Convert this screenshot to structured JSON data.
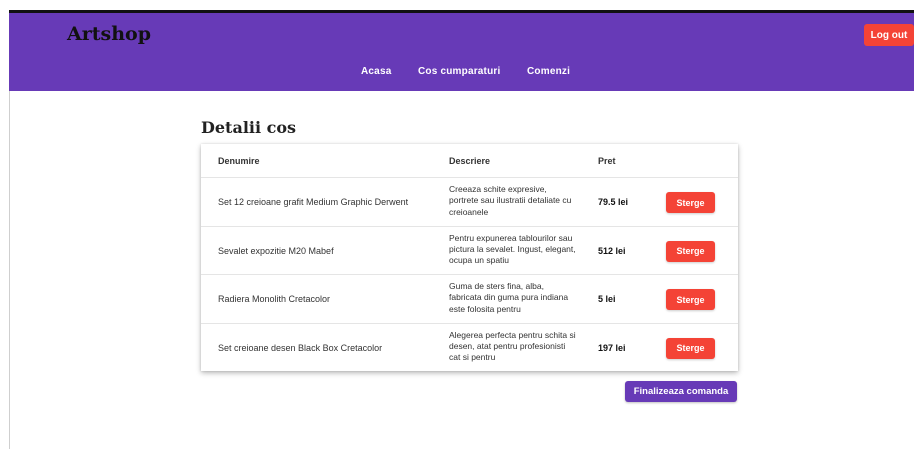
{
  "theme": {
    "accent": "#673ab7",
    "danger": "#f44336"
  },
  "header": {
    "brand": "Artshop",
    "logout_label": "Log out",
    "nav": [
      {
        "label": "Acasa"
      },
      {
        "label": "Cos cumparaturi"
      },
      {
        "label": "Comenzi"
      }
    ]
  },
  "main": {
    "title": "Detalii cos",
    "table": {
      "headers": {
        "name": "Denumire",
        "description": "Descriere",
        "price": "Pret"
      },
      "rows": [
        {
          "name": "Set 12 creioane grafit Medium Graphic Derwent",
          "description": "Creeaza schite expresive, portrete sau ilustratii detaliate cu creioanele",
          "price": "79.5 lei",
          "action": "Sterge"
        },
        {
          "name": "Sevalet expozitie M20 Mabef",
          "description": "Pentru expunerea tablourilor sau pictura la sevalet. Ingust, elegant, ocupa un spatiu",
          "price": "512 lei",
          "action": "Sterge"
        },
        {
          "name": "Radiera Monolith Cretacolor",
          "description": "Guma de sters fina, alba, fabricata din guma pura indiana este folosita pentru",
          "price": "5 lei",
          "action": "Sterge"
        },
        {
          "name": "Set creioane desen Black Box Cretacolor",
          "description": "Alegerea perfecta pentru schita si desen, atat pentru profesionisti cat si pentru",
          "price": "197 lei",
          "action": "Sterge"
        }
      ]
    },
    "finalize_label": "Finalizeaza comanda"
  }
}
